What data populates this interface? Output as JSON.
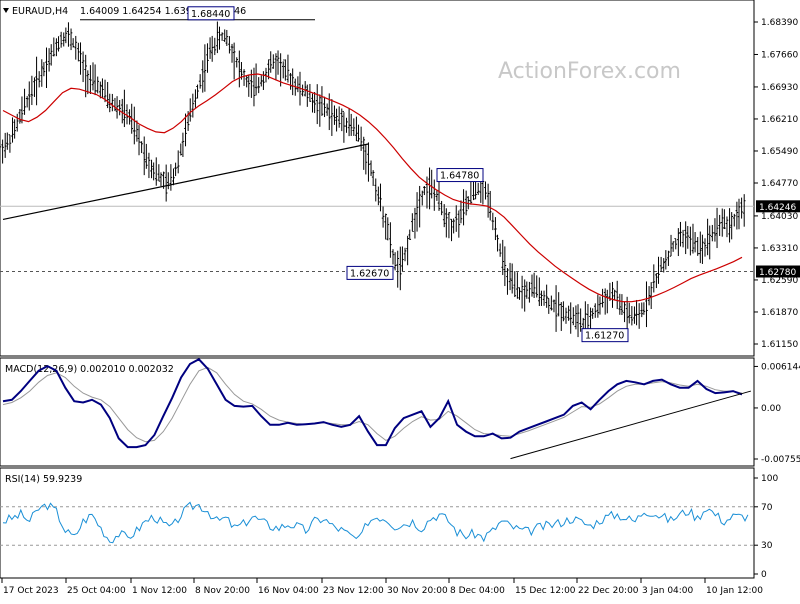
{
  "header": {
    "symbol": "EURAUD,H4",
    "ohlc": "1.64009 1.64254 1.63920 1.64246"
  },
  "watermark": "ActionForex.com",
  "colors": {
    "price_line": "#000000",
    "ma_line": "#cc0000",
    "macd_line": "#000080",
    "signal_line": "#999999",
    "rsi_line": "#1a8fd6",
    "level_box_border": "#000080",
    "grid_dash": "#999999"
  },
  "chart_data": [
    {
      "type": "line",
      "panel": "price",
      "y_ticks": [
        "1.68390",
        "1.67660",
        "1.66930",
        "1.66210",
        "1.65490",
        "1.64770",
        "1.64030",
        "1.63310",
        "1.62590",
        "1.61870",
        "1.61150"
      ],
      "ylim": [
        1.6097,
        1.6875
      ],
      "x_ticks": [
        "17 Oct 2023",
        "25 Oct 04:00",
        "1 Nov 12:00",
        "8 Nov 20:00",
        "16 Nov 04:00",
        "23 Nov 12:00",
        "30 Nov 20:00",
        "8 Dec 04:00",
        "15 Dec 12:00",
        "22 Dec 20:00",
        "3 Jan 04:00",
        "10 Jan 12:00"
      ],
      "series": [
        {
          "values": [
            1.656,
            1.659,
            1.663,
            1.667,
            1.67,
            1.673,
            1.676,
            1.679,
            1.681,
            1.68,
            1.676,
            1.672,
            1.67,
            1.669,
            1.666,
            1.665,
            1.664,
            1.662,
            1.658,
            1.654,
            1.651,
            1.649,
            1.647,
            1.65,
            1.656,
            1.662,
            1.668,
            1.673,
            1.678,
            1.68,
            1.681,
            1.677,
            1.673,
            1.67,
            1.669,
            1.671,
            1.674,
            1.675,
            1.673,
            1.671,
            1.669,
            1.668,
            1.666,
            1.665,
            1.664,
            1.662,
            1.662,
            1.661,
            1.659,
            1.655,
            1.65,
            1.644,
            1.638,
            1.63,
            1.628,
            1.635,
            1.641,
            1.646,
            1.647,
            1.644,
            1.64,
            1.638,
            1.64,
            1.643,
            1.646,
            1.647,
            1.644,
            1.636,
            1.629,
            1.625,
            1.623,
            1.623,
            1.624,
            1.623,
            1.621,
            1.62,
            1.619,
            1.618,
            1.617,
            1.616,
            1.618,
            1.62,
            1.622,
            1.623,
            1.62,
            1.618,
            1.617,
            1.619,
            1.623,
            1.627,
            1.63,
            1.633,
            1.635,
            1.636,
            1.634,
            1.633,
            1.635,
            1.638,
            1.639,
            1.638,
            1.641,
            1.6424
          ]
        },
        {
          "name": "MA",
          "values": [
            1.664,
            1.663,
            1.662,
            1.6615,
            1.6625,
            1.664,
            1.666,
            1.668,
            1.669,
            1.6688,
            1.6682,
            1.6676,
            1.6665,
            1.665,
            1.6636,
            1.6624,
            1.661,
            1.66,
            1.6592,
            1.659,
            1.66,
            1.6615,
            1.6635,
            1.665,
            1.6662,
            1.6675,
            1.669,
            1.6705,
            1.6715,
            1.672,
            1.6722,
            1.6718,
            1.671,
            1.6702,
            1.6696,
            1.669,
            1.6683,
            1.6676,
            1.6668,
            1.666,
            1.6652,
            1.6642,
            1.663,
            1.6615,
            1.6598,
            1.6578,
            1.6556,
            1.6532,
            1.651,
            1.649,
            1.6475,
            1.6462,
            1.645,
            1.644,
            1.6434,
            1.643,
            1.6428,
            1.6425,
            1.6415,
            1.64,
            1.638,
            1.636,
            1.634,
            1.6322,
            1.6306,
            1.629,
            1.6276,
            1.6263,
            1.625,
            1.6238,
            1.6228,
            1.622,
            1.6214,
            1.621,
            1.621,
            1.6213,
            1.6218,
            1.6225,
            1.6233,
            1.6242,
            1.6252,
            1.6262,
            1.627,
            1.6277,
            1.6284,
            1.6292,
            1.63,
            1.631
          ]
        }
      ],
      "level_labels": [
        {
          "text": "1.68440",
          "value": 1.6844
        },
        {
          "text": "1.64780",
          "value": 1.6478
        },
        {
          "text": "1.62670",
          "value": 1.6267
        },
        {
          "text": "1.61270",
          "value": 1.6127
        }
      ],
      "current_price": {
        "text": "1.64246",
        "value": 1.64246
      },
      "dashed_level": {
        "text": "1.62780",
        "value": 1.6278
      },
      "trendline": {
        "from": [
          0,
          1.6395
        ],
        "to": [
          50,
          1.6565
        ]
      }
    },
    {
      "type": "line",
      "panel": "macd",
      "title": "MACD(12,26,9) 0.002010 0.002032",
      "y_ticks": [
        "0.006144",
        "0.00",
        "-0.007555"
      ],
      "ylim": [
        -0.008,
        0.0068
      ],
      "series": [
        {
          "name": "MACD",
          "values": [
            0.001,
            0.0012,
            0.0025,
            0.004,
            0.0055,
            0.0062,
            0.0055,
            0.003,
            0.001,
            0.0008,
            0.0012,
            0.0005,
            -0.0015,
            -0.0045,
            -0.0058,
            -0.0058,
            -0.0055,
            -0.004,
            -0.0012,
            0.0015,
            0.0045,
            0.0065,
            0.0072,
            0.0058,
            0.0035,
            0.0012,
            0.0003,
            0.0002,
            0.0003,
            -0.0012,
            -0.0025,
            -0.0025,
            -0.0022,
            -0.0025,
            -0.0024,
            -0.0023,
            -0.0021,
            -0.0025,
            -0.0028,
            -0.0025,
            -0.0012,
            -0.0035,
            -0.0055,
            -0.0055,
            -0.003,
            -0.0015,
            -0.001,
            -0.0005,
            -0.0028,
            -0.0015,
            0.001,
            -0.0025,
            -0.0035,
            -0.0042,
            -0.0042,
            -0.0038,
            -0.0045,
            -0.0044,
            -0.0035,
            -0.003,
            -0.0025,
            -0.002,
            -0.0015,
            -0.001,
            0.0003,
            0.0008,
            -0.0002,
            0.0012,
            0.0025,
            0.0035,
            0.004,
            0.0038,
            0.0035,
            0.004,
            0.0042,
            0.0035,
            0.003,
            0.003,
            0.004,
            0.0028,
            0.0022,
            0.0023,
            0.0025,
            0.002
          ]
        },
        {
          "name": "Signal",
          "values": [
            0.0005,
            0.0008,
            0.0015,
            0.0025,
            0.0038,
            0.0048,
            0.0052,
            0.0045,
            0.0032,
            0.0022,
            0.0016,
            0.0012,
            0.0002,
            -0.0015,
            -0.0032,
            -0.0044,
            -0.005,
            -0.0048,
            -0.0035,
            -0.0015,
            0.001,
            0.0035,
            0.0055,
            0.006,
            0.0052,
            0.0035,
            0.002,
            0.001,
            0.0006,
            -0.0002,
            -0.0012,
            -0.0018,
            -0.0021,
            -0.0023,
            -0.0024,
            -0.0023,
            -0.0022,
            -0.0023,
            -0.0025,
            -0.0025,
            -0.002,
            -0.0025,
            -0.0038,
            -0.0048,
            -0.0042,
            -0.003,
            -0.002,
            -0.0013,
            -0.0018,
            -0.0017,
            -0.0005,
            -0.0012,
            -0.0022,
            -0.0032,
            -0.0038,
            -0.0039,
            -0.0041,
            -0.0042,
            -0.0038,
            -0.0034,
            -0.0029,
            -0.0024,
            -0.0019,
            -0.0014,
            -0.0006,
            0.0002,
            0.0001,
            0.0006,
            0.0015,
            0.0025,
            0.0032,
            0.0035,
            0.0035,
            0.0037,
            0.0039,
            0.0037,
            0.0034,
            0.0032,
            0.0035,
            0.0032,
            0.0027,
            0.0025,
            0.0025,
            0.0022
          ]
        }
      ],
      "trendline": {
        "from": [
          57,
          -0.0075
        ],
        "to": [
          84,
          0.0025
        ]
      }
    },
    {
      "type": "line",
      "panel": "rsi",
      "title": "RSI(14) 59.9239",
      "y_ticks": [
        "100",
        "70",
        "30",
        "0"
      ],
      "ylim": [
        0,
        100
      ],
      "levels": [
        70,
        30
      ],
      "series": [
        {
          "name": "RSI",
          "values": [
            55,
            58,
            62,
            55,
            68,
            72,
            65,
            45,
            38,
            55,
            62,
            48,
            35,
            42,
            38,
            45,
            55,
            60,
            52,
            48,
            62,
            70,
            72,
            66,
            55,
            58,
            48,
            52,
            60,
            55,
            50,
            48,
            52,
            50,
            45,
            55,
            58,
            50,
            46,
            40,
            35,
            55,
            60,
            58,
            50,
            52,
            55,
            48,
            58,
            62,
            56,
            44,
            40,
            42,
            38,
            45,
            55,
            50,
            46,
            44,
            48,
            50,
            52,
            55,
            58,
            54,
            50,
            56,
            60,
            62,
            58,
            55,
            66,
            64,
            60,
            56,
            62,
            66,
            58,
            70,
            62,
            55,
            60,
            60
          ]
        }
      ]
    }
  ]
}
